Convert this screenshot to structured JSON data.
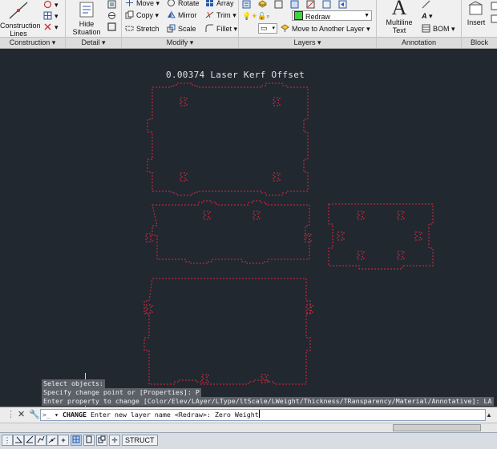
{
  "ribbon": {
    "construction": {
      "group_label": "Construction ▾",
      "lines_label": "Construction Lines"
    },
    "detail": {
      "group_label": "Detail ▾",
      "hide_label": "Hide Situation"
    },
    "modify": {
      "group_label": "Modify ▾",
      "move": "Move",
      "rotate": "Rotate",
      "array": "Array",
      "copy": "Copy",
      "mirror": "Mirror",
      "trim": "Trim",
      "stretch": "Stretch",
      "scale": "Scale",
      "fillet": "Fillet"
    },
    "layers": {
      "group_label": "Layers ▾",
      "current_layer": "Redraw",
      "current_layer_color": "#3fd33f",
      "move_to_layer": "Move to Another Layer"
    },
    "annotation": {
      "group_label": "Annotation",
      "multiline_label": "Multiline Text",
      "big_glyph": "A",
      "bom_label": "BOM"
    },
    "block": {
      "group_label": "Block",
      "insert_label": "Insert"
    }
  },
  "drawing": {
    "title": "0.00374 Laser Kerf Offset",
    "line_color": "#e0283c",
    "background": "#212830"
  },
  "command": {
    "history": [
      "Select objects:",
      "Specify change point or [Properties]: P",
      "Enter property to change [Color/Elev/LAyer/LType/ltScale/LWeight/Thickness/TRansparency/Material/Annotative]: LA"
    ],
    "prompt_keyword": "CHANGE",
    "prompt_text": "Enter new layer name <Redraw>:",
    "input_value": "Zero Weight"
  },
  "status": {
    "struct_label": "STRUCT"
  }
}
